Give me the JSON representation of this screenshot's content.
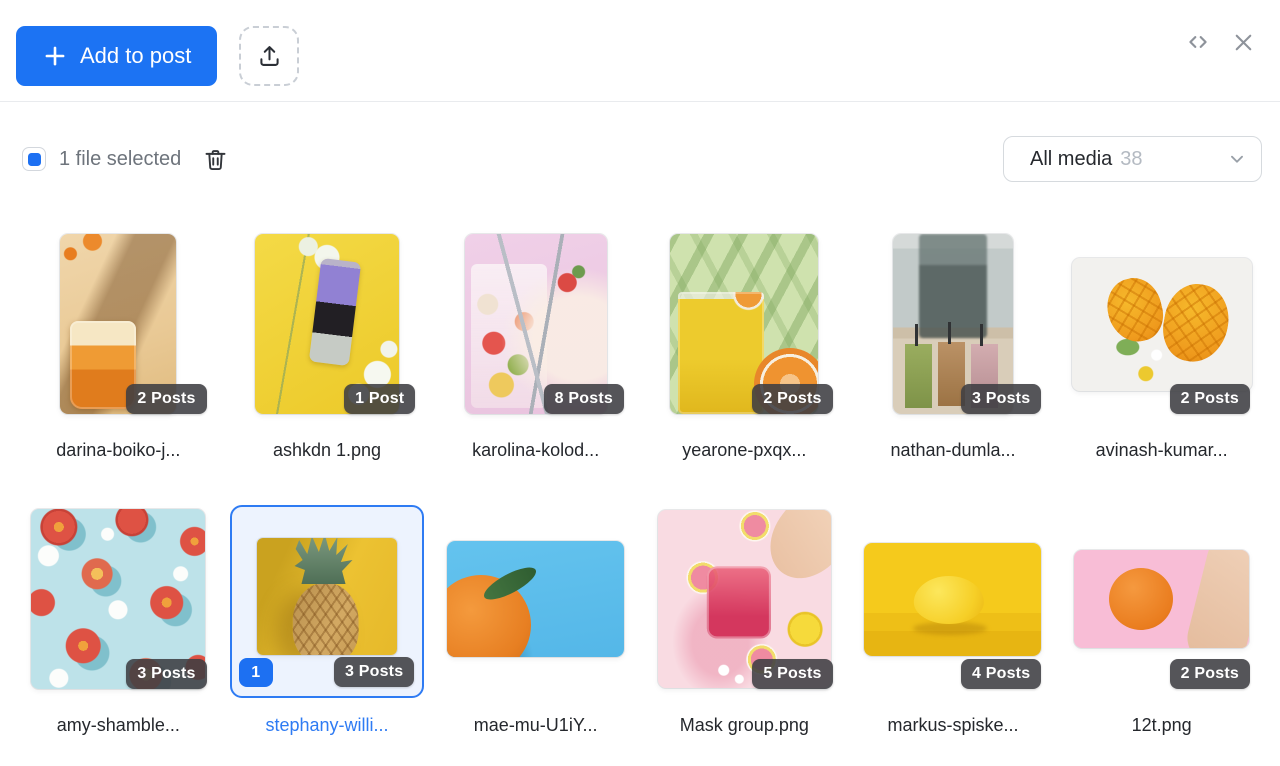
{
  "header": {
    "add_to_post": "Add to post"
  },
  "toolbar": {
    "selection_text": "1 file selected",
    "filter": {
      "label": "All media",
      "count": "38"
    }
  },
  "colors": {
    "accent_blue": "#1c73f3",
    "selected_border": "#2e7bf3",
    "badge_bg": "rgba(61,62,66,0.88)"
  },
  "icons": {
    "plus": "plus-icon",
    "upload": "upload-icon",
    "expand": "expand-code-icon",
    "close": "close-icon",
    "trash": "trash-icon",
    "chevron": "chevron-down-icon"
  },
  "media": {
    "items": [
      {
        "name": "darina-boiko-j...",
        "posts": "2 Posts",
        "selected": false,
        "image": "orange iced drink with peel on beige background"
      },
      {
        "name": "ashkdn 1.png",
        "posts": "1 Post",
        "selected": false,
        "image": "purple juice bottle with white flowers on yellow background"
      },
      {
        "name": "karolina-kolod...",
        "posts": "8 Posts",
        "selected": false,
        "image": "fruit lemonade glasses with strawberries on pink background"
      },
      {
        "name": "yearone-pxqx...",
        "posts": "2 Posts",
        "selected": false,
        "image": "orange juice glass with palm leaves"
      },
      {
        "name": "nathan-dumla...",
        "posts": "3 Posts",
        "selected": false,
        "image": "three smoothie cups in a cafe"
      },
      {
        "name": "avinash-kumar...",
        "posts": "2 Posts",
        "selected": false,
        "image": "cut mangoes on white background"
      },
      {
        "name": "amy-shamble...",
        "posts": "3 Posts",
        "selected": false,
        "image": "peach pattern on turquoise background"
      },
      {
        "name": "stephany-willi...",
        "posts": "3 Posts",
        "selected": true,
        "selection_order": "1",
        "image": "pineapple on yellow background"
      },
      {
        "name": "mae-mu-U1iY...",
        "posts": null,
        "selected": false,
        "image": "orange with leaf on blue background"
      },
      {
        "name": "Mask group.png",
        "posts": "5 Posts",
        "selected": false,
        "image": "hand dropping grapefruit slice into pink drink"
      },
      {
        "name": "markus-spiske...",
        "posts": "4 Posts",
        "selected": false,
        "image": "lemon on yellow background"
      },
      {
        "name": "12t.png",
        "posts": "2 Posts",
        "selected": false,
        "image": "hand holding orange on pink background"
      }
    ]
  }
}
